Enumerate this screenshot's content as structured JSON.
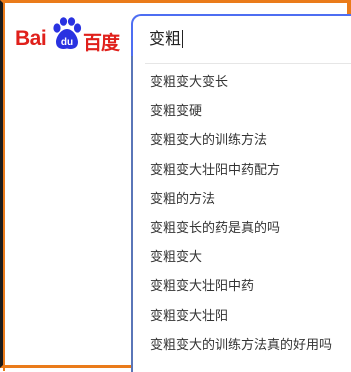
{
  "logo": {
    "latin": "Bai",
    "paw_text": "du",
    "chinese": "百度",
    "brand_color": "#e0201b",
    "paw_color": "#2932e1"
  },
  "search": {
    "query": "变粗",
    "accent_color": "#4e6ef2"
  },
  "suggestions": [
    {
      "text": "变粗变大变长"
    },
    {
      "text": "变粗变硬"
    },
    {
      "text": "变粗变大的训练方法"
    },
    {
      "text": "变粗变大壮阳中药配方"
    },
    {
      "text": "变粗的方法"
    },
    {
      "text": "变粗变长的药是真的吗"
    },
    {
      "text": "变粗变大"
    },
    {
      "text": "变粗变大壮阳中药"
    },
    {
      "text": "变粗变大壮阳"
    },
    {
      "text": "变粗变大的训练方法真的好用吗"
    }
  ],
  "frame": {
    "border_color": "#ea7b1a"
  }
}
